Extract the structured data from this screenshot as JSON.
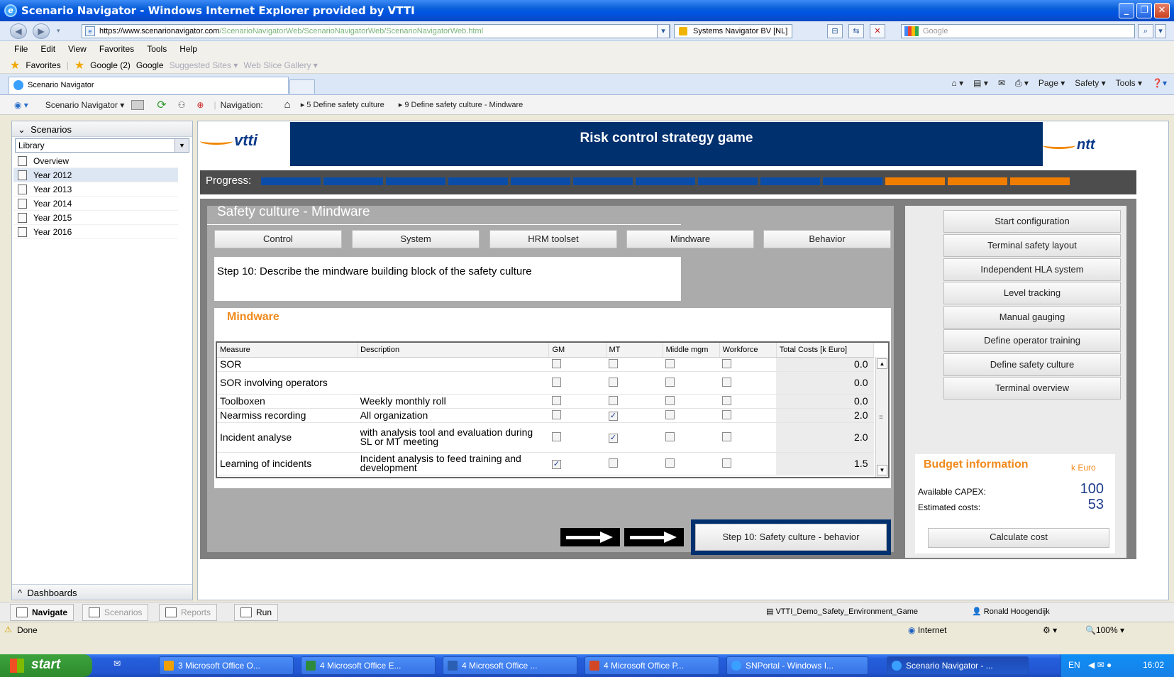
{
  "window": {
    "title": "Scenario Navigator - Windows Internet Explorer provided by VTTI"
  },
  "address": {
    "url_host": "https://www.scenarionavigator.com",
    "url_path": "/ScenarioNavigatorWeb/ScenarioNavigatorWeb/ScenarioNavigatorWeb.html",
    "cert": "Systems Navigator BV [NL]",
    "search_placeholder": "Google"
  },
  "menu": [
    "File",
    "Edit",
    "View",
    "Favorites",
    "Tools",
    "Help"
  ],
  "favorites": {
    "label": "Favorites",
    "items": [
      "Google (2)",
      "Google",
      "Suggested Sites ▾",
      "Web Slice Gallery ▾"
    ]
  },
  "tab": {
    "title": "Scenario Navigator"
  },
  "commandbar": [
    "Page ▾",
    "Safety ▾",
    "Tools ▾"
  ],
  "apptoolbar": {
    "app_menu": "Scenario Navigator ▾",
    "navigation_label": "Navigation:",
    "crumbs": [
      "▸ 5 Define safety culture",
      "▸ 9 Define safety culture - Mindware"
    ]
  },
  "sidebar": {
    "header": "Scenarios",
    "select_value": "Library",
    "items": [
      "Overview",
      "Year 2012",
      "Year 2013",
      "Year 2014",
      "Year 2015",
      "Year 2016"
    ],
    "footer": "Dashboards"
  },
  "game": {
    "title": "Risk control strategy game",
    "logo_left": "vtti",
    "logo_right": "ntt",
    "progress_label": "Progress:",
    "progress": {
      "completed_segments": 10,
      "total_segments": 13,
      "done_color": "#0a4da8",
      "todo_color": "#f07d00"
    }
  },
  "panel": {
    "title": "Safety culture - Mindware",
    "tabs": [
      "Control",
      "System",
      "HRM toolset",
      "Mindware",
      "Behavior"
    ],
    "step_text": "Step 10: Describe the mindware building block of the safety culture",
    "section_title": "Mindware",
    "columns": [
      "Measure",
      "Description",
      "GM",
      "MT",
      "Middle mgm",
      "Workforce",
      "Total Costs [k Euro]"
    ],
    "rows": [
      {
        "measure": "SOR",
        "description": "",
        "gm": false,
        "mt": false,
        "mid": false,
        "wf": false,
        "cost": "0.0"
      },
      {
        "measure": "SOR involving operators",
        "description": "",
        "gm": false,
        "mt": false,
        "mid": false,
        "wf": false,
        "cost": "0.0"
      },
      {
        "measure": "Toolboxen",
        "description": "Weekly monthly roll",
        "gm": false,
        "mt": false,
        "mid": false,
        "wf": false,
        "cost": "0.0"
      },
      {
        "measure": "Nearmiss recording",
        "description": "All organization",
        "gm": false,
        "mt": true,
        "mid": false,
        "wf": false,
        "cost": "2.0"
      },
      {
        "measure": "Incident analyse",
        "description": "with analysis tool and evaluation during SL or MT meeting",
        "gm": false,
        "mt": true,
        "mid": false,
        "wf": false,
        "cost": "2.0"
      },
      {
        "measure": "Learning of incidents",
        "description": "Incident analysis to feed training and development",
        "gm": true,
        "mt": false,
        "mid": false,
        "wf": false,
        "cost": "1.5"
      }
    ],
    "next_button": "Step 10: Safety culture - behavior"
  },
  "rightnav": {
    "buttons": [
      "Start configuration",
      "Terminal safety layout",
      "Independent HLA system",
      "Level tracking",
      "Manual gauging",
      "Define operator training",
      "Define safety culture",
      "Terminal overview"
    ]
  },
  "budget": {
    "title": "Budget information",
    "unit": "k Euro",
    "capex_label": "Available CAPEX:",
    "capex_value": "100",
    "est_label": "Estimated costs:",
    "est_value": "53",
    "calc_button": "Calculate cost"
  },
  "bottomtabs": {
    "tabs": [
      "Navigate",
      "Scenarios",
      "Reports",
      "Run"
    ],
    "project": "VTTI_Demo_Safety_Environment_Game",
    "user": "Ronald Hoogendijk"
  },
  "status": {
    "left": "Done",
    "zone": "Internet",
    "zoom": "100%"
  },
  "taskbar": {
    "start": "start",
    "tasks": [
      "3 Microsoft Office O...",
      "4 Microsoft Office E...",
      "4 Microsoft Office ...",
      "4 Microsoft Office P...",
      "SNPortal - Windows I...",
      "Scenario Navigator - ..."
    ],
    "lang": "EN",
    "clock": "16:02"
  }
}
